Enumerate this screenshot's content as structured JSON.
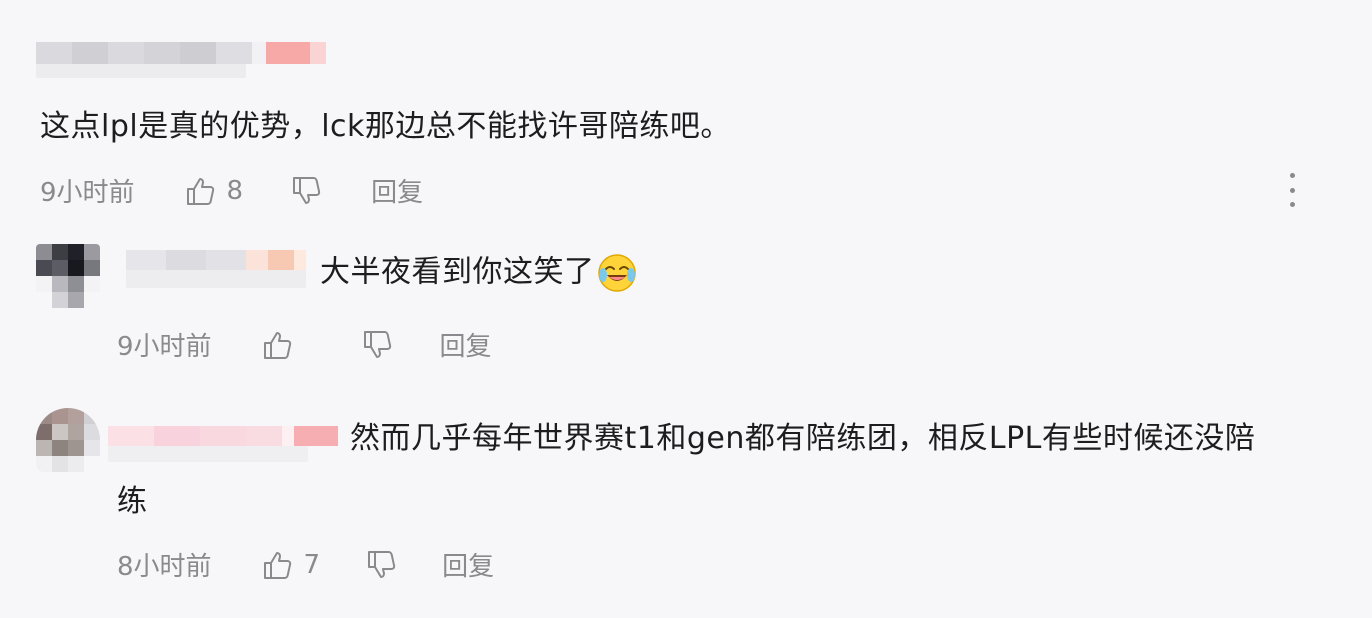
{
  "comments": [
    {
      "text": "这点lpl是真的优势，lck那边总不能找许哥陪练吧。",
      "time": "9小时前",
      "likes": "8",
      "reply_label": "回复",
      "more_icon": "more-vertical-icon"
    },
    {
      "text": "大半夜看到你这笑了",
      "emoji": "laughing-crying-emoji",
      "time": "9小时前",
      "likes": "",
      "reply_label": "回复"
    },
    {
      "text_line1": "然而几乎每年世界赛t1和gen都有陪练团，相反LPL有些时候还没陪",
      "text_line2": "练",
      "time": "8小时前",
      "likes": "7",
      "reply_label": "回复"
    }
  ],
  "colors": {
    "background": "#f7f7f9",
    "text": "#1d1d1f",
    "meta": "#8a8a8e"
  }
}
